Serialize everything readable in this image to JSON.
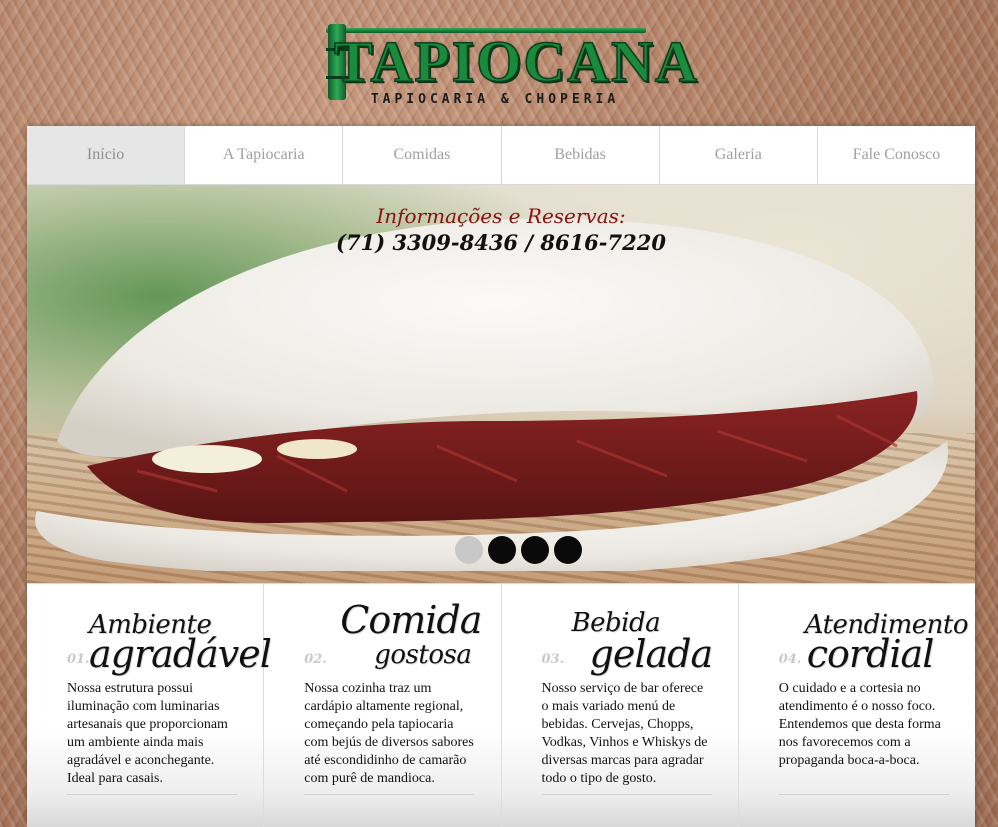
{
  "header": {
    "logo_brand": "TAPIOCANA",
    "logo_subtitle": "TAPIOCARIA & CHOPERIA"
  },
  "nav": {
    "items": [
      "Início",
      "A Tapiocaria",
      "Comidas",
      "Bebidas",
      "Galeria",
      "Fale Conosco"
    ],
    "active": "Início"
  },
  "hero": {
    "title": "Informações e Reservas:",
    "phone": "(71) 3309-8436 / 8616-7220",
    "image": "tapioca-with-dried-meat-and-cheese",
    "slider_active_index": 0,
    "slider_count": 4
  },
  "features": [
    {
      "number": "01.",
      "title_small": "Ambiente",
      "title_big": "agradável",
      "text": "Nossa estrutura possui iluminação com luminarias artesanais que proporcionam um ambiente ainda mais agradável e aconchegante. Ideal para casais."
    },
    {
      "number": "02.",
      "title_small": "gostosa",
      "title_big": "Comida",
      "text": "Nossa cozinha traz um cardápio altamente regional, começando pela tapiocaria com bejús de diversos sabores até escondidinho de camarão com purê de mandioca."
    },
    {
      "number": "03.",
      "title_small": "Bebida",
      "title_big": "gelada",
      "text": "Nosso serviço de bar oferece o mais variado menú de bebidas. Cervejas, Chopps, Vodkas, Vinhos e Whiskys de diversas marcas para agradar todo o tipo de gosto."
    },
    {
      "number": "04.",
      "title_small": "Atendimento",
      "title_big": "cordial",
      "text": "O cuidado e a cortesia no atendimento é o nosso foco. Entendemos que desta forma nos favorecemos com a propaganda boca-a-boca."
    }
  ],
  "colors": {
    "brand_green": "#1a8a3c",
    "hero_title_red": "#8a1010",
    "nav_text": "#a0a0a0"
  }
}
